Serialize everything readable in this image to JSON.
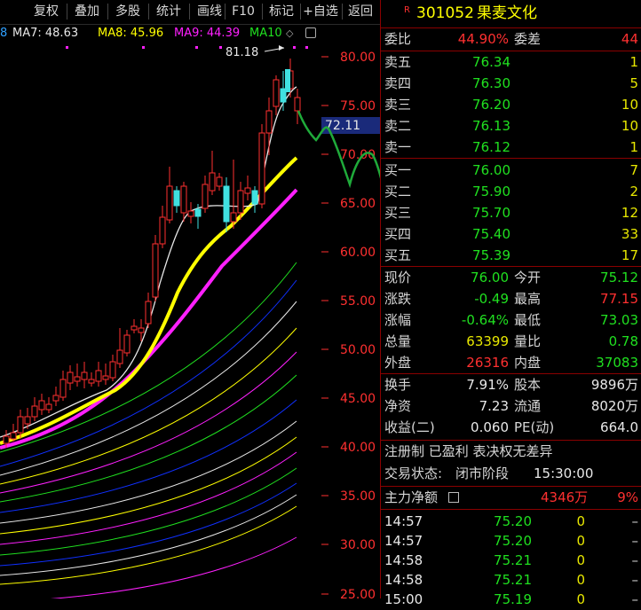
{
  "toolbar": {
    "buttons": [
      "复权",
      "叠加",
      "多股",
      "统计",
      "画线",
      "F10",
      "标记",
      "+自选",
      "返回"
    ]
  },
  "ma_legend": {
    "partial": "8",
    "items": [
      {
        "label": "MA7: 48.63",
        "color": "#e8e8e8"
      },
      {
        "label": "MA8: 45.96",
        "color": "#ffff00"
      },
      {
        "label": "MA9: 44.39",
        "color": "#ff20ff"
      },
      {
        "label": "MA10",
        "color": "#20e020"
      }
    ],
    "settings_icon": "square-icon"
  },
  "chart": {
    "price_axis": [
      "80.00",
      "75.00",
      "70.00",
      "65.00",
      "60.00",
      "55.00",
      "50.00",
      "45.00",
      "40.00",
      "35.00",
      "30.00",
      "25.00"
    ],
    "high_annotation": "81.18",
    "current_price_tag": "72.11",
    "colors": {
      "up": "#ff3030",
      "down": "#40e0e0",
      "ma7": "#e8e8e8",
      "ma8": "#ffff00",
      "ma9": "#ff20ff",
      "drawing": "#1faa3a"
    }
  },
  "header": {
    "badge": "R",
    "code": "301052",
    "name": "果麦文化"
  },
  "ratio": {
    "weibi_label": "委比",
    "weibi_value": "44.90%",
    "weicha_label": "委差",
    "weicha_value": "44"
  },
  "asks": [
    {
      "label": "卖五",
      "price": "76.34",
      "qty": "1"
    },
    {
      "label": "卖四",
      "price": "76.30",
      "qty": "5"
    },
    {
      "label": "卖三",
      "price": "76.20",
      "qty": "10"
    },
    {
      "label": "卖二",
      "price": "76.13",
      "qty": "10"
    },
    {
      "label": "卖一",
      "price": "76.12",
      "qty": "1"
    }
  ],
  "bids": [
    {
      "label": "买一",
      "price": "76.00",
      "qty": "7"
    },
    {
      "label": "买二",
      "price": "75.90",
      "qty": "2"
    },
    {
      "label": "买三",
      "price": "75.70",
      "qty": "12"
    },
    {
      "label": "买四",
      "price": "75.40",
      "qty": "33"
    },
    {
      "label": "买五",
      "price": "75.39",
      "qty": "17"
    }
  ],
  "stats": [
    {
      "l1": "现价",
      "v1": "76.00",
      "c1": "green",
      "l2": "今开",
      "v2": "75.12",
      "c2": "green"
    },
    {
      "l1": "涨跌",
      "v1": "-0.49",
      "c1": "green",
      "l2": "最高",
      "v2": "77.15",
      "c2": "red"
    },
    {
      "l1": "涨幅",
      "v1": "-0.64%",
      "c1": "green",
      "l2": "最低",
      "v2": "73.03",
      "c2": "green"
    },
    {
      "l1": "总量",
      "v1": "63399",
      "c1": "yellow",
      "l2": "量比",
      "v2": "0.78",
      "c2": "green"
    },
    {
      "l1": "外盘",
      "v1": "26316",
      "c1": "red",
      "l2": "内盘",
      "v2": "37083",
      "c2": "green"
    }
  ],
  "stats2": [
    {
      "l1": "换手",
      "v1": "7.91%",
      "l2": "股本",
      "v2": "9896万"
    },
    {
      "l1": "净资",
      "v1": "7.23",
      "l2": "流通",
      "v2": "8020万"
    },
    {
      "l1": "收益(二)",
      "v1": "0.060",
      "l2": "PE(动)",
      "v2": "664.0"
    }
  ],
  "tags": "注册制  已盈利  表决权无差异",
  "trade_status": {
    "label": "交易状态:",
    "value": "闭市阶段",
    "time": "15:30:00"
  },
  "main_net": {
    "label": "主力净额",
    "value": "4346万",
    "percent": "9%"
  },
  "ticks": [
    {
      "time": "14:57",
      "price": "75.20",
      "qty": "0",
      "flag": "–"
    },
    {
      "time": "14:57",
      "price": "75.20",
      "qty": "0",
      "flag": "–"
    },
    {
      "time": "14:58",
      "price": "75.21",
      "qty": "0",
      "flag": "–"
    },
    {
      "time": "14:58",
      "price": "75.21",
      "qty": "0",
      "flag": "–"
    },
    {
      "time": "15:00",
      "price": "75.19",
      "qty": "0",
      "flag": "–"
    }
  ]
}
